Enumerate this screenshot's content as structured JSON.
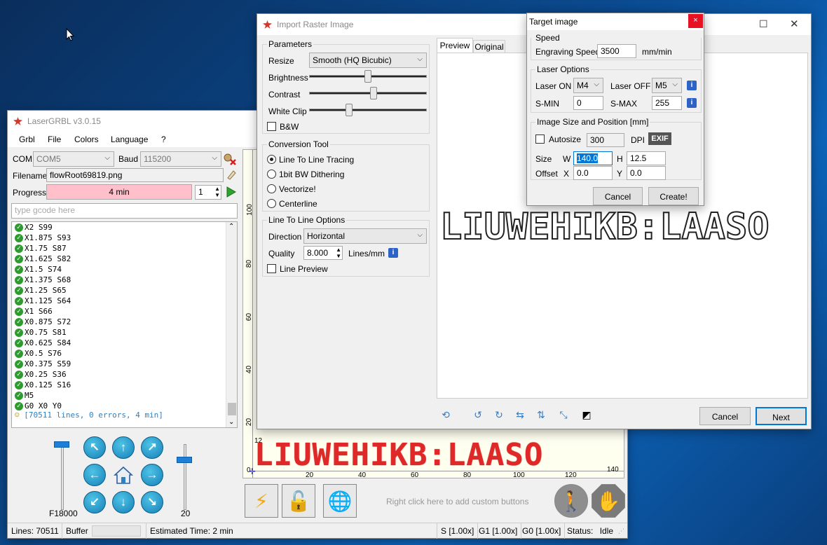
{
  "lasergrbl": {
    "title": "LaserGRBL v3.0.15",
    "menu": [
      "Grbl",
      "File",
      "Colors",
      "Language",
      "?"
    ],
    "com_label": "COM",
    "com_value": "COM5",
    "baud_label": "Baud",
    "baud_value": "115200",
    "filename_label": "Filename",
    "filename_value": "flowRoot69819.png",
    "progress_label": "Progress",
    "progress_value": "4 min",
    "copies_value": "1",
    "gcode_placeholder": "type gcode here",
    "log_lines": [
      "X2 S99",
      "X1.875 S93",
      "X1.75 S87",
      "X1.625 S82",
      "X1.5 S74",
      "X1.375 S68",
      "X1.25 S65",
      "X1.125 S64",
      "X1 S66",
      "X0.875 S72",
      "X0.75 S81",
      "X0.625 S84",
      "X0.5 S76",
      "X0.375 S59",
      "X0.25 S36",
      "X0.125 S16",
      "M5",
      "G0 X0 Y0"
    ],
    "log_summary": "[70511 lines, 0 errors, 4 min]",
    "feed_label": "F18000",
    "step_label": "20",
    "custom_buttons_hint": "Right click here to add custom buttons",
    "preview_text": "LIUWEHIKB:LAASO",
    "ruler_left": [
      "100",
      "80",
      "60",
      "40",
      "20",
      "0"
    ],
    "ruler_bottom": [
      "20",
      "40",
      "60",
      "80",
      "100",
      "120",
      "140"
    ],
    "ruler_top_value": "12",
    "ruler_right_value": "140",
    "status": {
      "lines_label": "Lines:",
      "lines_value": "70511",
      "buffer_label": "Buffer",
      "estimated_label": "Estimated Time:",
      "estimated_value": "2 min",
      "s_override": "S [1.00x]",
      "g1_override": "G1 [1.00x]",
      "g0_override": "G0 [1.00x]",
      "status_label": "Status:",
      "status_value": "Idle"
    }
  },
  "import": {
    "title": "Import Raster Image",
    "parameters_group": "Parameters",
    "resize_label": "Resize",
    "resize_value": "Smooth (HQ Bicubic)",
    "brightness_label": "Brightness",
    "contrast_label": "Contrast",
    "whiteclip_label": "White Clip",
    "brightness_level": 0.5,
    "contrast_level": 0.55,
    "whiteclip_level": 0.33,
    "bw_label": "B&W",
    "conversion_group": "Conversion Tool",
    "conversion_options": [
      "Line To Line Tracing",
      "1bit BW Dithering",
      "Vectorize!",
      "Centerline"
    ],
    "line_options_group": "Line To Line Options",
    "direction_label": "Direction",
    "direction_value": "Horizontal",
    "quality_label": "Quality",
    "quality_value": "8.000",
    "quality_unit": "Lines/mm",
    "line_preview_label": "Line Preview",
    "tab_preview": "Preview",
    "tab_original": "Original",
    "cancel": "Cancel",
    "next": "Next"
  },
  "target": {
    "title": "Target image",
    "close": "×",
    "speed_group": "Speed",
    "engraving_speed_label": "Engraving Speed",
    "engraving_speed_value": "3500",
    "speed_unit": "mm/min",
    "laser_group": "Laser Options",
    "laser_on_label": "Laser ON",
    "laser_on_value": "M4",
    "laser_off_label": "Laser OFF",
    "laser_off_value": "M5",
    "smin_label": "S-MIN",
    "smin_value": "0",
    "smax_label": "S-MAX",
    "smax_value": "255",
    "size_group": "Image Size and Position [mm]",
    "autosize_label": "Autosize",
    "dpi_value": "300",
    "dpi_label": "DPI",
    "exif_label": "EXIF",
    "size_label": "Size",
    "w_label": "W",
    "w_value": "140.0",
    "h_label": "H",
    "h_value": "12.5",
    "offset_label": "Offset",
    "x_label": "X",
    "x_value": "0.0",
    "y_label": "Y",
    "y_value": "0.0",
    "cancel": "Cancel",
    "create": "Create!"
  }
}
